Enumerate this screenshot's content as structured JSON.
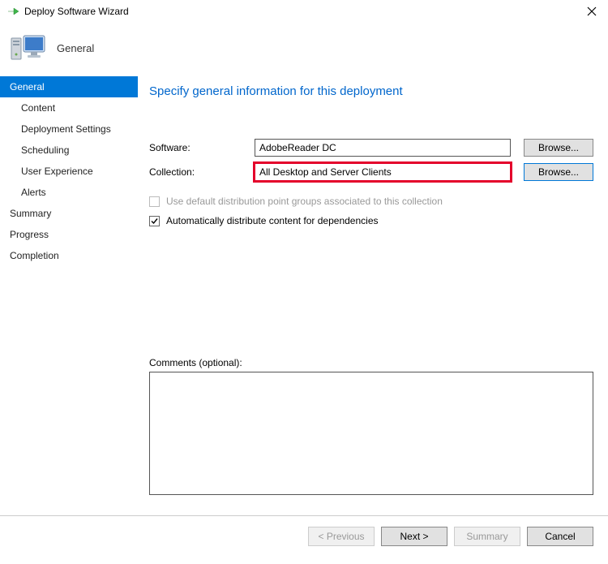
{
  "window": {
    "title": "Deploy Software Wizard"
  },
  "header": {
    "step_title": "General"
  },
  "sidebar": {
    "items": [
      {
        "label": "General",
        "selected": true,
        "sub": false
      },
      {
        "label": "Content",
        "selected": false,
        "sub": true
      },
      {
        "label": "Deployment Settings",
        "selected": false,
        "sub": true
      },
      {
        "label": "Scheduling",
        "selected": false,
        "sub": true
      },
      {
        "label": "User Experience",
        "selected": false,
        "sub": true
      },
      {
        "label": "Alerts",
        "selected": false,
        "sub": true
      },
      {
        "label": "Summary",
        "selected": false,
        "sub": false
      },
      {
        "label": "Progress",
        "selected": false,
        "sub": false
      },
      {
        "label": "Completion",
        "selected": false,
        "sub": false
      }
    ]
  },
  "main": {
    "heading": "Specify general information for this deployment",
    "software_label": "Software:",
    "software_value": "AdobeReader DC",
    "collection_label": "Collection:",
    "collection_value": "All Desktop and Server Clients",
    "browse_label": "Browse...",
    "checkbox_distpoint": "Use default distribution point groups associated to this collection",
    "checkbox_autodist": "Automatically distribute content for dependencies",
    "comments_label": "Comments (optional):",
    "comments_value": ""
  },
  "footer": {
    "previous": "< Previous",
    "next": "Next >",
    "summary": "Summary",
    "cancel": "Cancel"
  }
}
